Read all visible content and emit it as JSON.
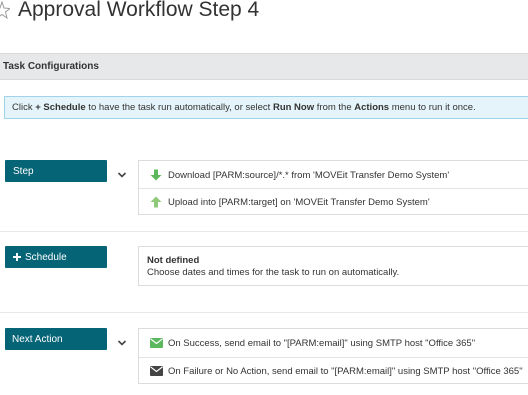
{
  "page": {
    "title": "Approval Workflow Step 4"
  },
  "section": {
    "header": "Task Configurations"
  },
  "info": {
    "part1": "Click ",
    "bold1": "+ Schedule",
    "part2": " to have the task run automatically, or select ",
    "bold2": "Run Now",
    "part3": " from the ",
    "bold3": "Actions",
    "part4": " menu to run it once."
  },
  "step": {
    "button_label": "Step",
    "items": [
      {
        "icon": "arrow-down-icon",
        "text": "Download [PARM:source]/*.* from 'MOVEit Transfer Demo System'"
      },
      {
        "icon": "arrow-up-icon",
        "text": "Upload into [PARM:target] on 'MOVEit Transfer Demo System'"
      }
    ]
  },
  "schedule": {
    "button_label": "Schedule",
    "status_title": "Not defined",
    "status_desc": "Choose dates and times for the task to run on automatically."
  },
  "next_action": {
    "button_label": "Next Action",
    "items": [
      {
        "icon": "envelope-green-icon",
        "text": "On Success, send email to \"[PARM:email]\" using SMTP host \"Office 365\""
      },
      {
        "icon": "envelope-dark-icon",
        "text": "On Failure or No Action, send email to \"[PARM:email]\" using SMTP host \"Office 365\""
      }
    ]
  },
  "colors": {
    "button_bg": "#066477",
    "info_bg": "#e5f4fa",
    "header_bg": "#e6e8ea",
    "green": "#5cb85c"
  }
}
